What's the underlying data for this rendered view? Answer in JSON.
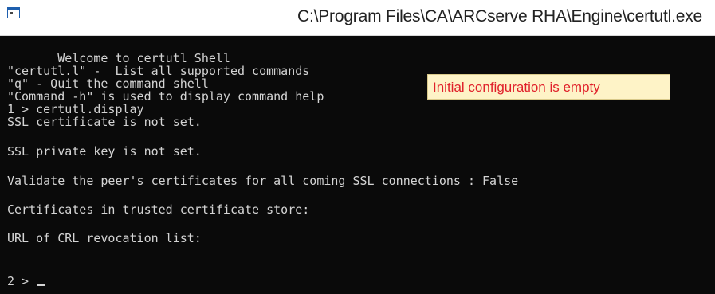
{
  "window": {
    "title": "C:\\Program Files\\CA\\ARCserve RHA\\Engine\\certutl.exe",
    "icon": "console-window-icon"
  },
  "console": {
    "lines": [
      "       Welcome to certutl Shell",
      "\"certutl.l\" -  List all supported commands",
      "\"q\" - Quit the command shell",
      "\"Command -h\" is used to display command help",
      "1 > certutl.display",
      "SSL certificate is not set.",
      "SSL private key is not set.",
      "Validate the peer's certificates for all coming SSL connections : False",
      "Certificates in trusted certificate store:",
      "URL of CRL revocation list:",
      "2 > "
    ]
  },
  "annotation": {
    "text": "Initial configuration is empty",
    "text_color": "#e0202a",
    "background": "#fef3c7"
  }
}
